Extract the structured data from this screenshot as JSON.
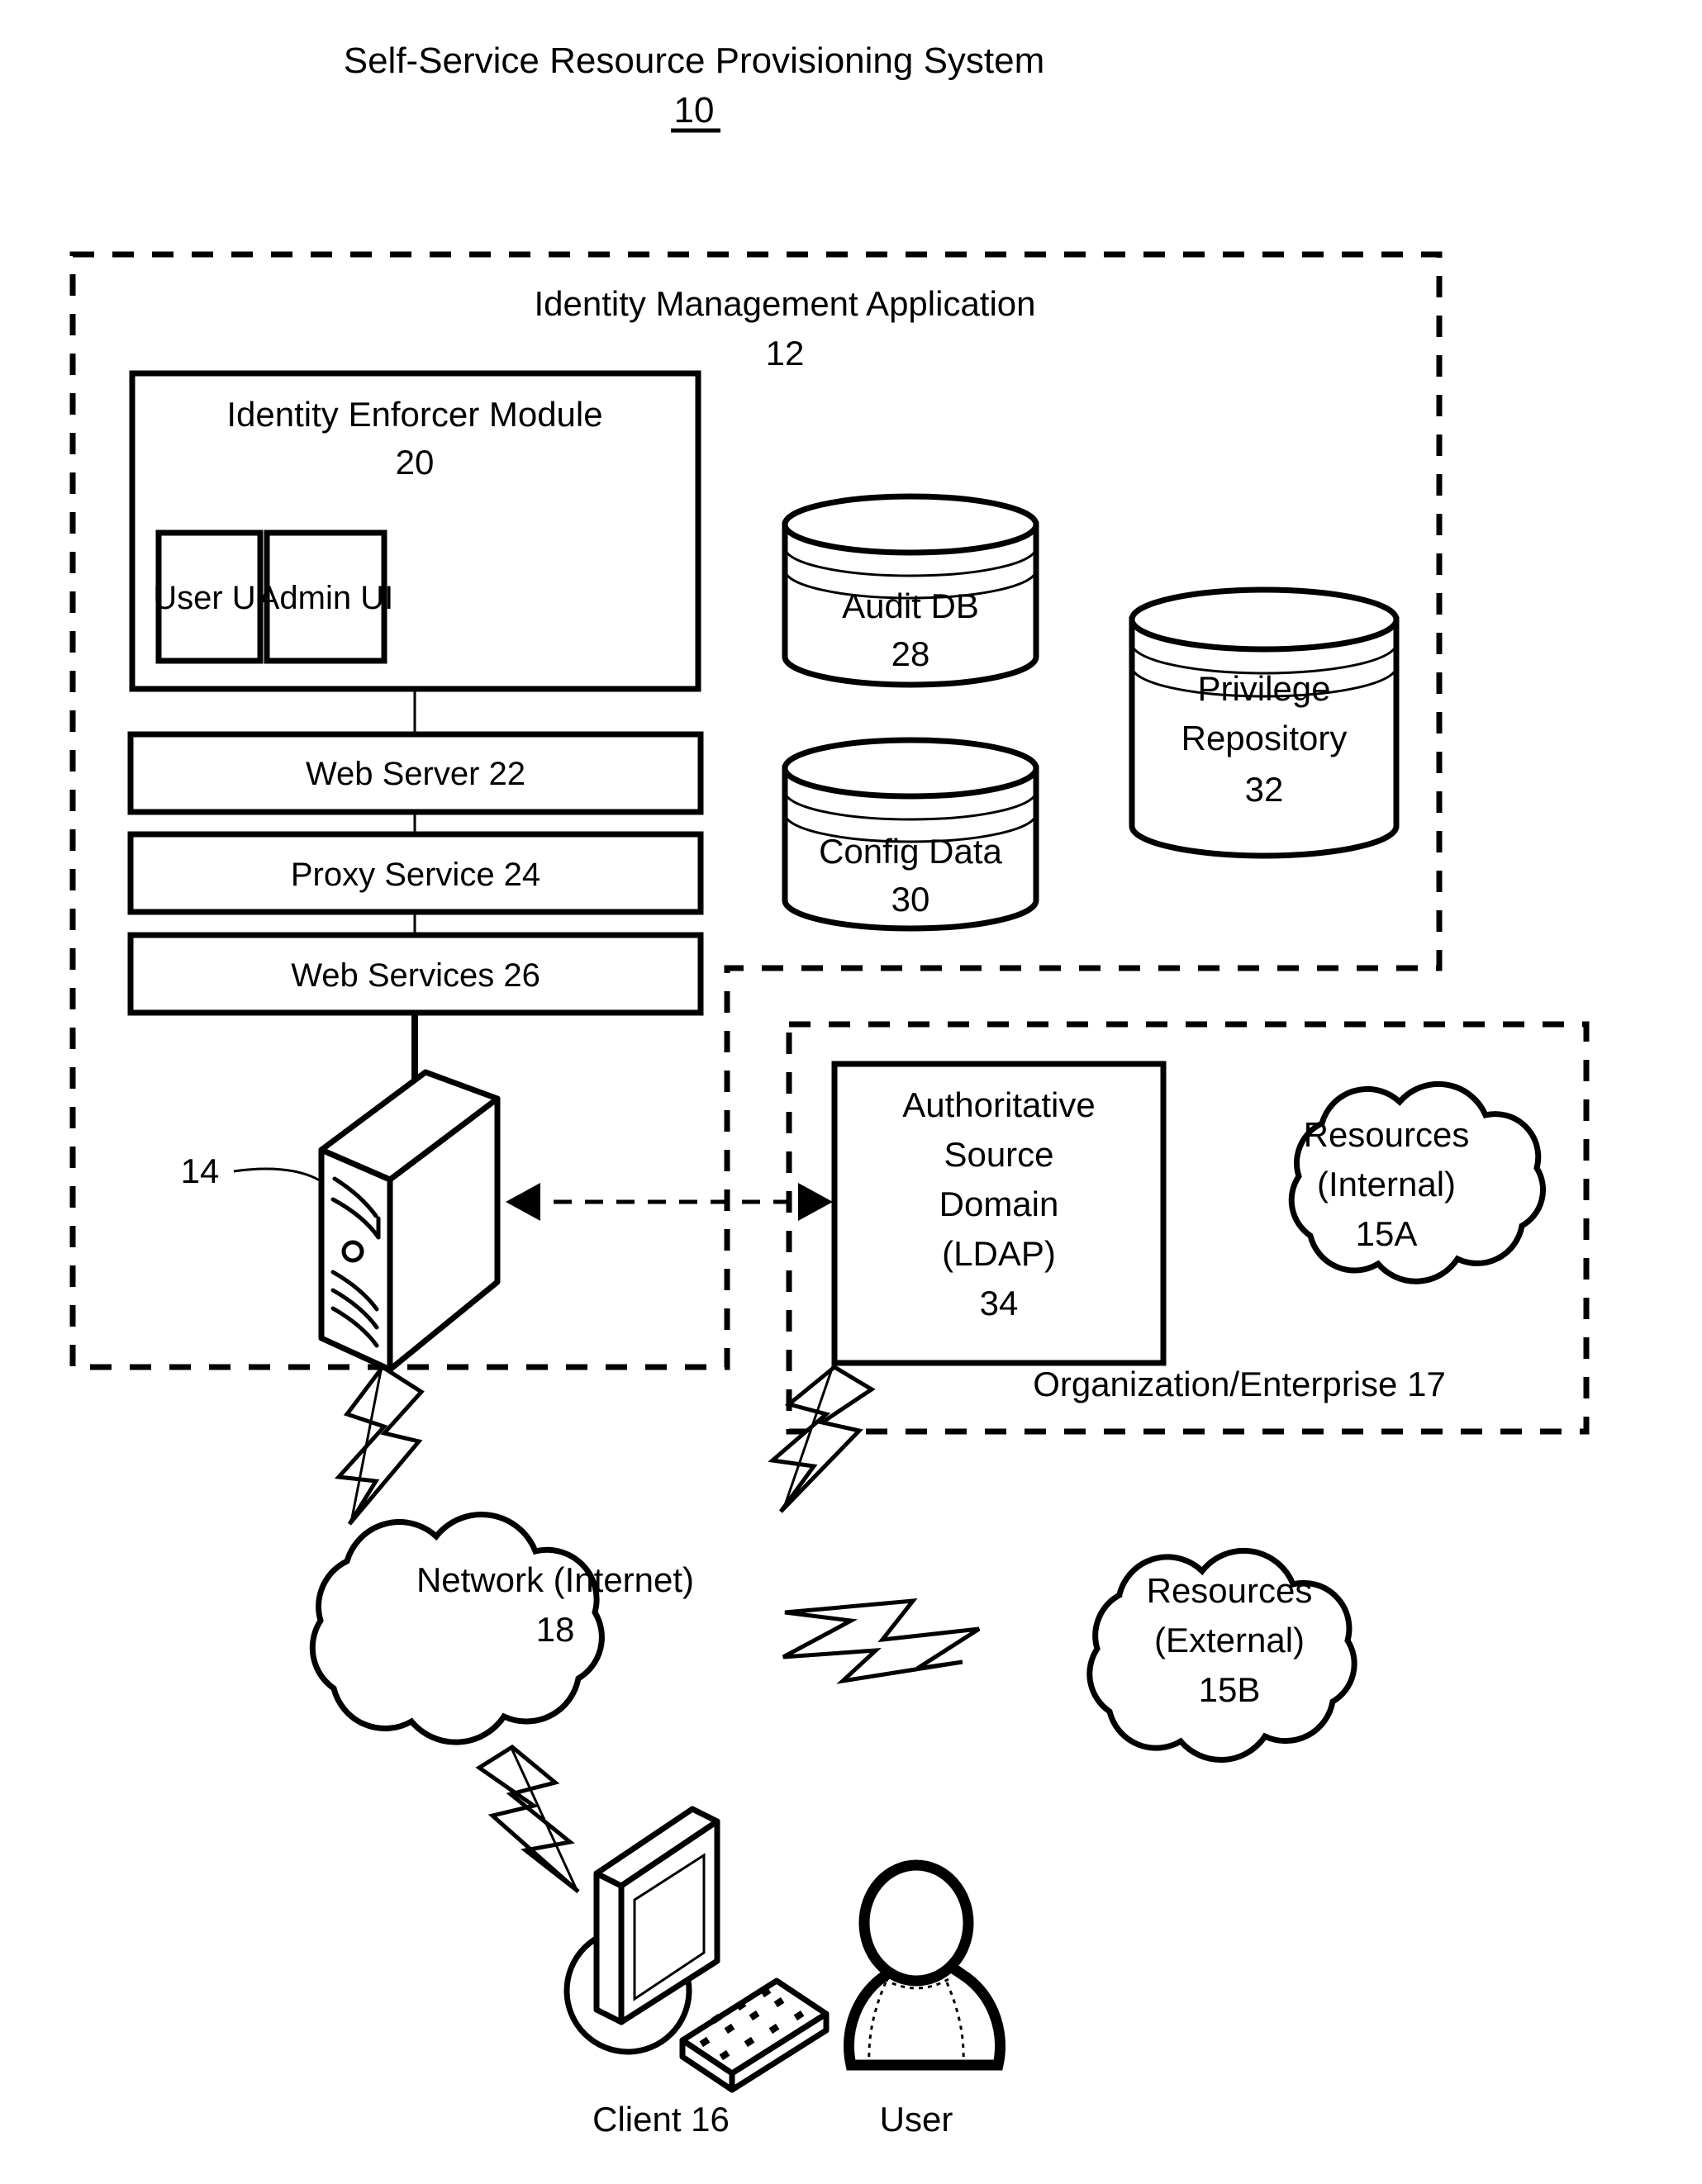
{
  "figure": {
    "title": "Self-Service Resource Provisioning System",
    "title_ref": "10"
  },
  "identity_management_application": {
    "label": "Identity Management Application",
    "ref": "12",
    "identity_enforcer_module": {
      "label": "Identity Enforcer Module",
      "ref": "20",
      "panels": [
        {
          "label": "User UI"
        },
        {
          "label": "Admin UI"
        }
      ]
    },
    "stack": [
      {
        "label": "Web Server 22"
      },
      {
        "label": "Proxy Service 24"
      },
      {
        "label": "Web Services 26"
      }
    ],
    "datastores": [
      {
        "label": "Audit DB",
        "ref": "28"
      },
      {
        "label": "Config Data",
        "ref": "30"
      },
      {
        "label": "Privilege Repository",
        "ref": "32"
      }
    ],
    "server": {
      "ref": "14"
    }
  },
  "organization": {
    "label": "Organization/Enterprise 17",
    "authoritative_source": {
      "line1": "Authoritative",
      "line2": "Source",
      "line3": "Domain",
      "line4": "(LDAP)",
      "ref": "34"
    },
    "resources_internal": {
      "line1": "Resources",
      "line2": "(Internal)",
      "ref": "15A"
    }
  },
  "network": {
    "label": "Network (Internet)",
    "ref": "18"
  },
  "resources_external": {
    "line1": "Resources",
    "line2": "(External)",
    "ref": "15B"
  },
  "client": {
    "label": "Client 16"
  },
  "user": {
    "label": "User"
  },
  "colors": {
    "ink": "#000000",
    "paper": "#ffffff"
  }
}
